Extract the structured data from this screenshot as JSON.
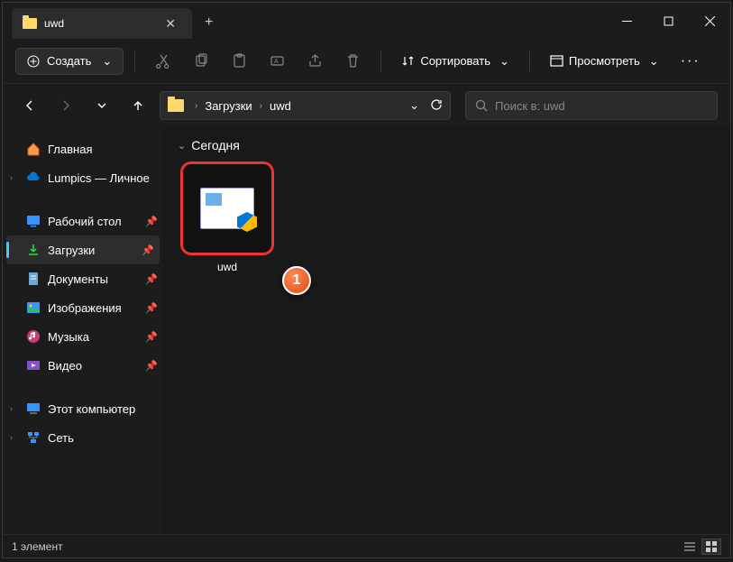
{
  "tab": {
    "title": "uwd"
  },
  "toolbar": {
    "create": "Создать",
    "sort": "Сортировать",
    "view": "Просмотреть"
  },
  "breadcrumb": {
    "items": [
      "Загрузки",
      "uwd"
    ]
  },
  "search": {
    "placeholder": "Поиск в: uwd"
  },
  "sidebar": {
    "home": "Главная",
    "personal": "Lumpics — Личное",
    "desktop": "Рабочий стол",
    "downloads": "Загрузки",
    "documents": "Документы",
    "pictures": "Изображения",
    "music": "Музыка",
    "videos": "Видео",
    "thispc": "Этот компьютер",
    "network": "Сеть"
  },
  "content": {
    "group": "Сегодня",
    "file": {
      "name": "uwd"
    },
    "callout": "1"
  },
  "status": {
    "count": "1 элемент"
  }
}
